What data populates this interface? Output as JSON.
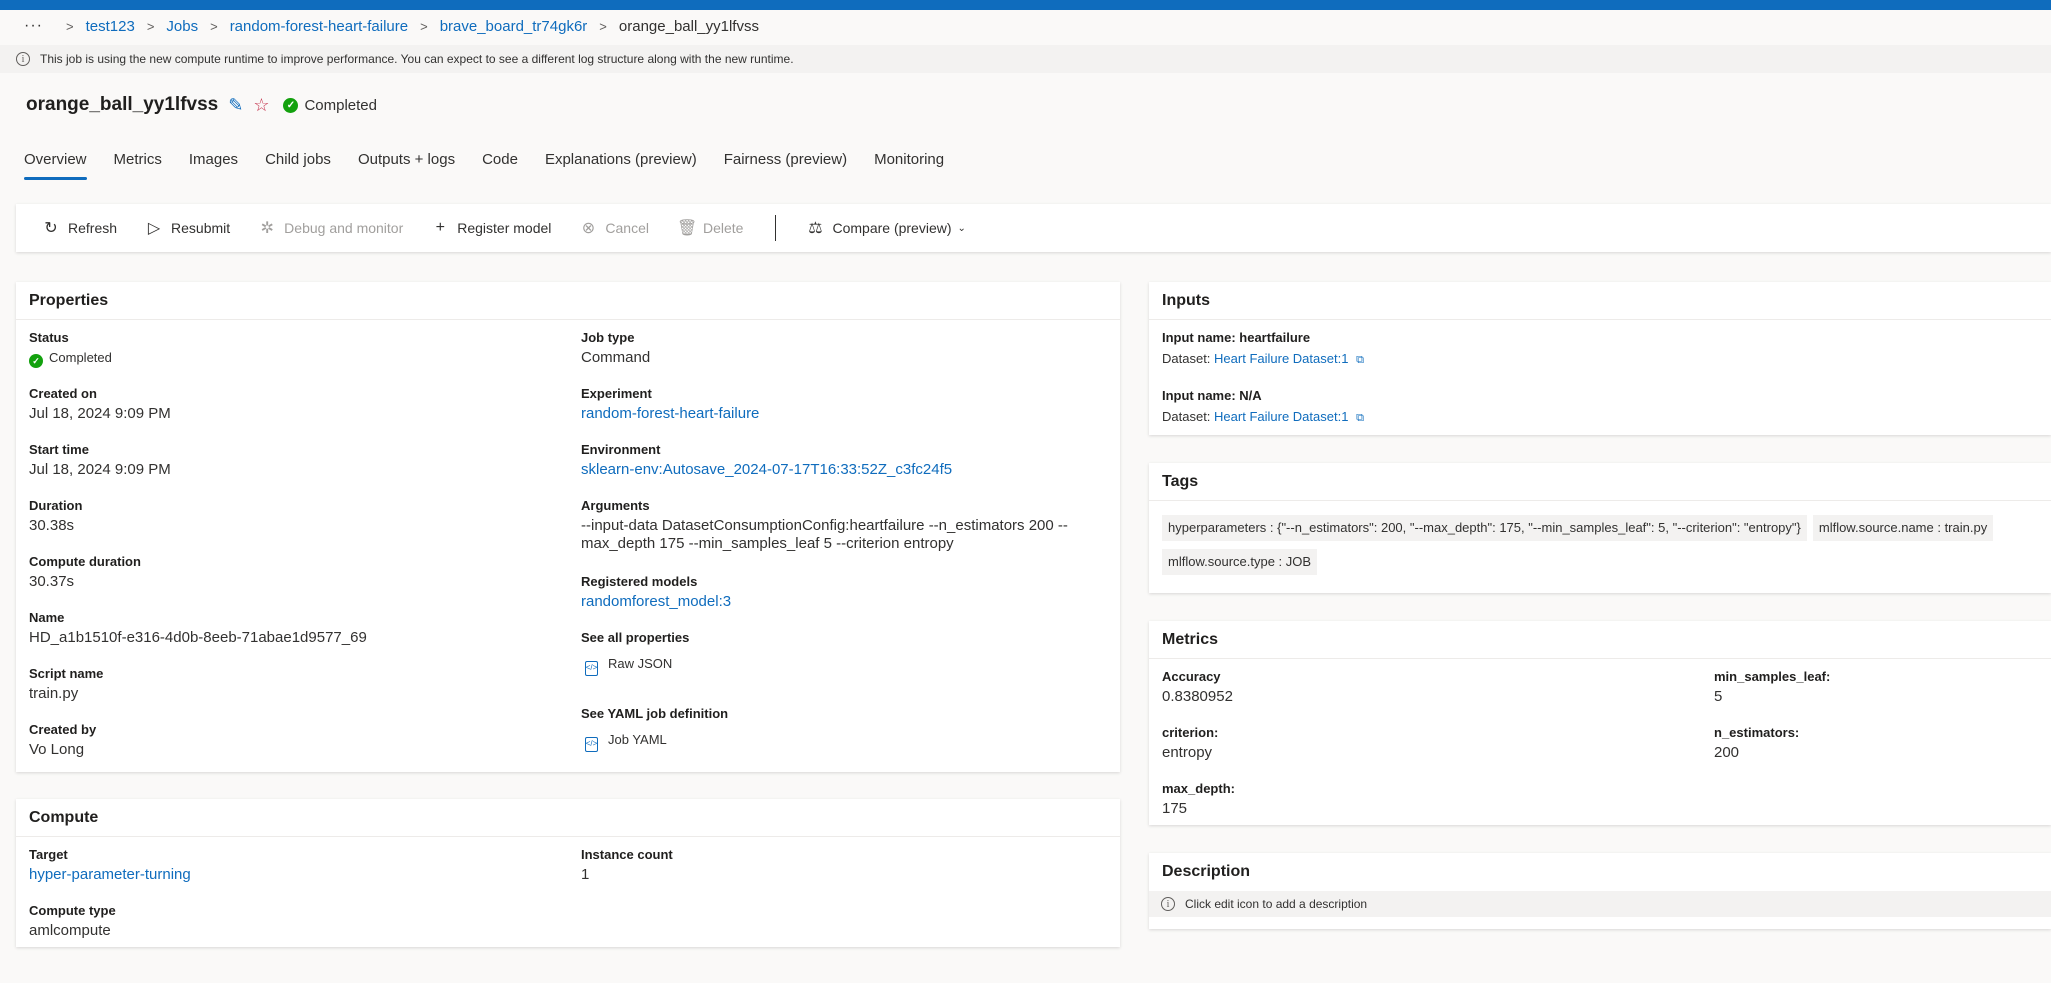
{
  "breadcrumb": {
    "more": "···",
    "items": [
      "test123",
      "Jobs",
      "random-forest-heart-failure",
      "brave_board_tr74gk6r"
    ],
    "current": "orange_ball_yy1lfvss"
  },
  "info_bar": "This job is using the new compute runtime to improve performance. You can expect to see a different log structure along with the new runtime.",
  "job": {
    "title": "orange_ball_yy1lfvss",
    "status": "Completed"
  },
  "tabs": [
    "Overview",
    "Metrics",
    "Images",
    "Child jobs",
    "Outputs + logs",
    "Code",
    "Explanations (preview)",
    "Fairness (preview)",
    "Monitoring"
  ],
  "toolbar": {
    "refresh": "Refresh",
    "resubmit": "Resubmit",
    "debug": "Debug and monitor",
    "register": "Register model",
    "cancel": "Cancel",
    "delete": "Delete",
    "compare": "Compare (preview)"
  },
  "properties": {
    "title": "Properties",
    "status_label": "Status",
    "status_value": "Completed",
    "created_on_label": "Created on",
    "created_on_value": "Jul 18, 2024 9:09 PM",
    "start_time_label": "Start time",
    "start_time_value": "Jul 18, 2024 9:09 PM",
    "duration_label": "Duration",
    "duration_value": "30.38s",
    "compute_duration_label": "Compute duration",
    "compute_duration_value": "30.37s",
    "name_label": "Name",
    "name_value": "HD_a1b1510f-e316-4d0b-8eeb-71abae1d9577_69",
    "script_label": "Script name",
    "script_value": "train.py",
    "created_by_label": "Created by",
    "created_by_value": "Vo Long",
    "job_type_label": "Job type",
    "job_type_value": "Command",
    "experiment_label": "Experiment",
    "experiment_value": "random-forest-heart-failure",
    "environment_label": "Environment",
    "environment_value": "sklearn-env:Autosave_2024-07-17T16:33:52Z_c3fc24f5",
    "arguments_label": "Arguments",
    "arguments_line1": "--input-data DatasetConsumptionConfig:heartfailure --n_estimators 200 --",
    "arguments_line2": "max_depth 175 --min_samples_leaf 5 --criterion entropy",
    "registered_label": "Registered models",
    "registered_value": "randomforest_model:3",
    "all_props_label": "See all properties",
    "raw_json": "Raw JSON",
    "yaml_label": "See YAML job definition",
    "job_yaml": "Job YAML"
  },
  "compute": {
    "title": "Compute",
    "target_label": "Target",
    "target_value": "hyper-parameter-turning",
    "compute_type_label": "Compute type",
    "compute_type_value": "amlcompute",
    "instance_label": "Instance count",
    "instance_value": "1"
  },
  "inputs": {
    "title": "Inputs",
    "items": [
      {
        "name": "Input name: heartfailure",
        "dataset_label": "Dataset:",
        "dataset": "Heart Failure Dataset:1"
      },
      {
        "name": "Input name: N/A",
        "dataset_label": "Dataset:",
        "dataset": "Heart Failure Dataset:1"
      }
    ]
  },
  "tags": {
    "title": "Tags",
    "items": [
      "hyperparameters : {\"--n_estimators\": 200, \"--max_depth\": 175, \"--min_samples_leaf\": 5, \"--criterion\": \"entropy\"}",
      "mlflow.source.name : train.py",
      "mlflow.source.type : JOB"
    ]
  },
  "metrics": {
    "title": "Metrics",
    "accuracy_label": "Accuracy",
    "accuracy_value": "0.8380952",
    "min_samples_label": "min_samples_leaf:",
    "min_samples_value": "5",
    "criterion_label": "criterion:",
    "criterion_value": "entropy",
    "n_estimators_label": "n_estimators:",
    "n_estimators_value": "200",
    "max_depth_label": "max_depth:",
    "max_depth_value": "175"
  },
  "description": {
    "title": "Description",
    "hint": "Click edit icon to add a description"
  }
}
